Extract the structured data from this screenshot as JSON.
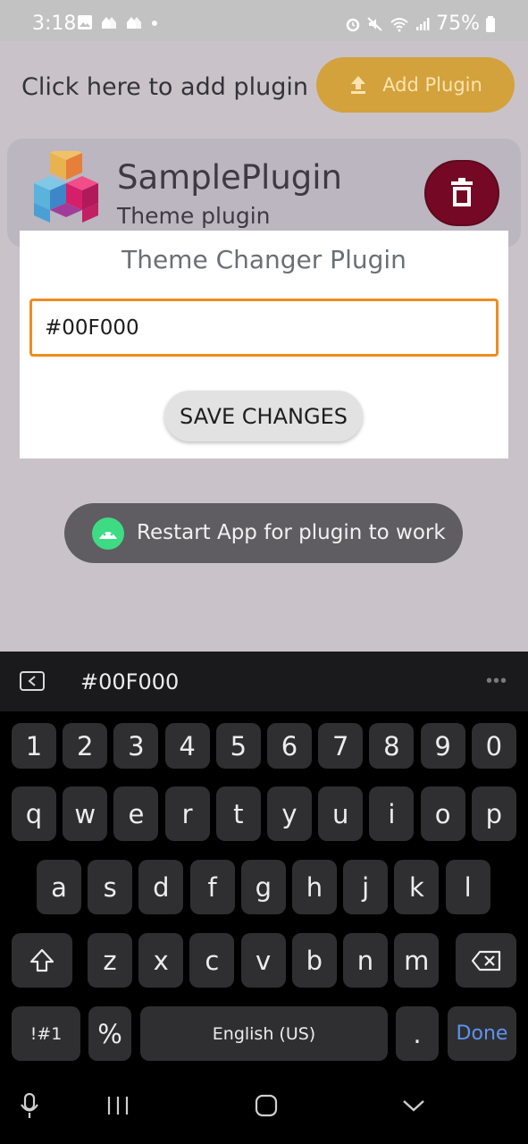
{
  "status_bar": {
    "time": "3:18",
    "battery_percent": "75%",
    "left_icons": [
      "image-icon",
      "cloud-icon",
      "cloud-icon",
      "dot-icon"
    ],
    "right_icons": [
      "alarm-icon",
      "mute-icon",
      "wifi-icon",
      "signal-icon",
      "battery-icon"
    ]
  },
  "header": {
    "add_label": "Click here to add plugin",
    "add_button_label": "Add Plugin"
  },
  "plugin": {
    "name": "SamplePlugin",
    "type": "Theme plugin"
  },
  "dialog": {
    "title": "Theme Changer Plugin",
    "color_value": "#00F000",
    "save_label": "SAVE CHANGES"
  },
  "toast": {
    "message": "Restart App for plugin to work"
  },
  "keyboard": {
    "suggestion": "#00F000",
    "row_numbers": [
      "1",
      "2",
      "3",
      "4",
      "5",
      "6",
      "7",
      "8",
      "9",
      "0"
    ],
    "row_top": [
      "q",
      "w",
      "e",
      "r",
      "t",
      "y",
      "u",
      "i",
      "o",
      "p"
    ],
    "row_middle": [
      "a",
      "s",
      "d",
      "f",
      "g",
      "h",
      "j",
      "k",
      "l"
    ],
    "row_bottom": [
      "z",
      "x",
      "c",
      "v",
      "b",
      "n",
      "m"
    ],
    "symbols_label": "!#1",
    "percent_label": "%",
    "space_label": "English (US)",
    "period_label": ".",
    "done_label": "Done"
  },
  "colors": {
    "accent_orange": "#ef8c1f",
    "add_button": "#d3a23d",
    "delete_button": "#750925",
    "done_blue": "#5f93f0",
    "android_green": "#3ddc84"
  }
}
